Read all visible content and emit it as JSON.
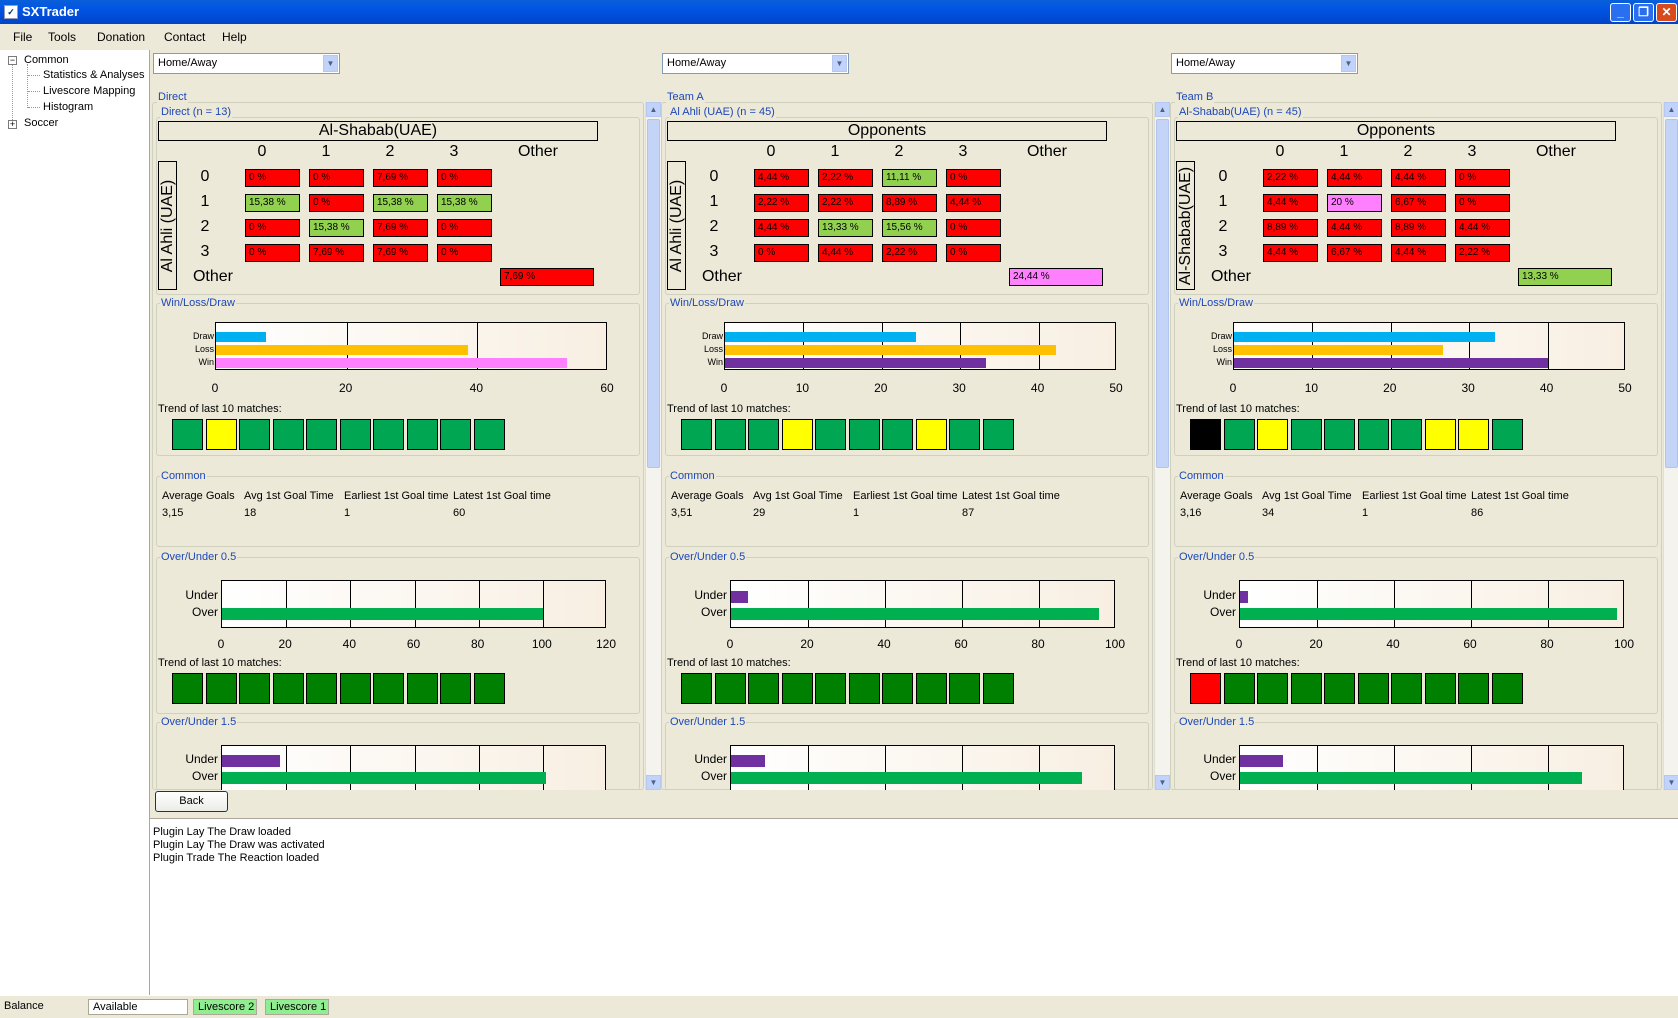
{
  "window": {
    "title": "SXTrader"
  },
  "menu": [
    "File",
    "Tools",
    "Donation",
    "Contact",
    "Help"
  ],
  "tree": {
    "common": "Common",
    "children": [
      "Statistics & Analyses",
      "Livescore Mapping",
      "Histogram"
    ],
    "soccer": "Soccer"
  },
  "panels": [
    {
      "combo": "Home/Away",
      "section": "Direct",
      "matrix_caption": "Direct (n = 13)",
      "matrix_header": "Al-Shabab(UAE)",
      "matrix_side": "Al Ahli (UAE)",
      "cols": [
        "0",
        "1",
        "2",
        "3",
        "Other"
      ],
      "rows": [
        "0",
        "1",
        "2",
        "3"
      ],
      "other_label": "Other",
      "cells": [
        [
          "0 %",
          "0 %",
          "7,69 %",
          "0 %"
        ],
        [
          "15,38 %",
          "0 %",
          "15,38 %",
          "15,38 %"
        ],
        [
          "0 %",
          "15,38 %",
          "7,69 %",
          "0 %"
        ],
        [
          "0 %",
          "7,69 %",
          "7,69 %",
          "0 %"
        ]
      ],
      "cell_colors": [
        [
          "#ff0000",
          "#ff0000",
          "#ff0000",
          "#ff0000"
        ],
        [
          "#92d050",
          "#ff0000",
          "#92d050",
          "#92d050"
        ],
        [
          "#ff0000",
          "#92d050",
          "#ff0000",
          "#ff0000"
        ],
        [
          "#ff0000",
          "#ff0000",
          "#ff0000",
          "#ff0000"
        ]
      ],
      "other_value": "7,69 %",
      "other_color": "#ff0000",
      "wld": {
        "caption": "Win/Loss/Draw",
        "labels": [
          "Draw",
          "Loss",
          "Win"
        ],
        "values": [
          7.7,
          38.5,
          53.8
        ],
        "colors": [
          "#00b0f0",
          "#ffc000",
          "#ff80ff"
        ],
        "ticks": [
          "0",
          "20",
          "40",
          "60"
        ],
        "max": 60
      },
      "trend_label": "Trend of last 10 matches:",
      "trend1": [
        "#00a651",
        "#ffff00",
        "#00a651",
        "#00a651",
        "#00a651",
        "#00a651",
        "#00a651",
        "#00a651",
        "#00a651",
        "#00a651"
      ],
      "common": {
        "caption": "Common",
        "headers": [
          "Average Goals",
          "Avg 1st Goal Time",
          "Earliest 1st Goal time",
          "Latest 1st Goal time"
        ],
        "values": [
          "3,15",
          "18",
          "1",
          "60"
        ]
      },
      "ou05": {
        "caption": "Over/Under 0.5",
        "labels": [
          "Under",
          "Over"
        ],
        "values": [
          0,
          100
        ],
        "ticks": [
          "0",
          "20",
          "40",
          "60",
          "80",
          "100",
          "120"
        ],
        "max": 120
      },
      "trend2": [
        "#008000",
        "#008000",
        "#008000",
        "#008000",
        "#008000",
        "#008000",
        "#008000",
        "#008000",
        "#008000",
        "#008000"
      ],
      "ou15": {
        "caption": "Over/Under 1.5",
        "labels": [
          "Under",
          "Over"
        ],
        "values": [
          18,
          101
        ],
        "max": 120
      }
    },
    {
      "combo": "Home/Away",
      "section": "Team A",
      "matrix_caption": "Al Ahli (UAE) (n = 45)",
      "matrix_header": "Opponents",
      "matrix_side": "Al Ahli (UAE)",
      "cols": [
        "0",
        "1",
        "2",
        "3",
        "Other"
      ],
      "rows": [
        "0",
        "1",
        "2",
        "3"
      ],
      "other_label": "Other",
      "cells": [
        [
          "4,44 %",
          "2,22 %",
          "11,11 %",
          "0 %"
        ],
        [
          "2,22 %",
          "2,22 %",
          "8,89 %",
          "4,44 %"
        ],
        [
          "4,44 %",
          "13,33 %",
          "15,56 %",
          "0 %"
        ],
        [
          "0 %",
          "4,44 %",
          "2,22 %",
          "0 %"
        ]
      ],
      "cell_colors": [
        [
          "#ff0000",
          "#ff0000",
          "#92d050",
          "#ff0000"
        ],
        [
          "#ff0000",
          "#ff0000",
          "#ff0000",
          "#ff0000"
        ],
        [
          "#ff0000",
          "#92d050",
          "#92d050",
          "#ff0000"
        ],
        [
          "#ff0000",
          "#ff0000",
          "#ff0000",
          "#ff0000"
        ]
      ],
      "other_value": "24,44 %",
      "other_color": "#ff80ff",
      "wld": {
        "caption": "Win/Loss/Draw",
        "labels": [
          "Draw",
          "Loss",
          "Win"
        ],
        "values": [
          24.4,
          42.2,
          33.3
        ],
        "colors": [
          "#00b0f0",
          "#ffc000",
          "#7030a0"
        ],
        "ticks": [
          "0",
          "10",
          "20",
          "30",
          "40",
          "50"
        ],
        "max": 50
      },
      "trend_label": "Trend of last 10 matches:",
      "trend1": [
        "#00a651",
        "#00a651",
        "#00a651",
        "#ffff00",
        "#00a651",
        "#00a651",
        "#00a651",
        "#ffff00",
        "#00a651",
        "#00a651"
      ],
      "common": {
        "caption": "Common",
        "headers": [
          "Average Goals",
          "Avg 1st Goal Time",
          "Earliest 1st Goal time",
          "Latest 1st Goal time"
        ],
        "values": [
          "3,51",
          "29",
          "1",
          "87"
        ]
      },
      "ou05": {
        "caption": "Over/Under 0.5",
        "labels": [
          "Under",
          "Over"
        ],
        "values": [
          4.4,
          95.6
        ],
        "ticks": [
          "0",
          "20",
          "40",
          "60",
          "80",
          "100"
        ],
        "max": 100
      },
      "trend2": [
        "#008000",
        "#008000",
        "#008000",
        "#008000",
        "#008000",
        "#008000",
        "#008000",
        "#008000",
        "#008000",
        "#008000"
      ],
      "ou15": {
        "caption": "Over/Under 1.5",
        "labels": [
          "Under",
          "Over"
        ],
        "values": [
          8.9,
          91.1
        ],
        "max": 100
      }
    },
    {
      "combo": "Home/Away",
      "section": "Team B",
      "matrix_caption": "Al-Shabab(UAE) (n = 45)",
      "matrix_header": "Opponents",
      "matrix_side": "Al-Shabab(UAE)",
      "cols": [
        "0",
        "1",
        "2",
        "3",
        "Other"
      ],
      "rows": [
        "0",
        "1",
        "2",
        "3"
      ],
      "other_label": "Other",
      "cells": [
        [
          "2,22 %",
          "4,44 %",
          "4,44 %",
          "0 %"
        ],
        [
          "4,44 %",
          "20 %",
          "6,67 %",
          "0 %"
        ],
        [
          "8,89 %",
          "4,44 %",
          "8,89 %",
          "4,44 %"
        ],
        [
          "4,44 %",
          "6,67 %",
          "4,44 %",
          "2,22 %"
        ]
      ],
      "cell_colors": [
        [
          "#ff0000",
          "#ff0000",
          "#ff0000",
          "#ff0000"
        ],
        [
          "#ff0000",
          "#ff80ff",
          "#ff0000",
          "#ff0000"
        ],
        [
          "#ff0000",
          "#ff0000",
          "#ff0000",
          "#ff0000"
        ],
        [
          "#ff0000",
          "#ff0000",
          "#ff0000",
          "#ff0000"
        ]
      ],
      "other_value": "13,33 %",
      "other_color": "#92d050",
      "wld": {
        "caption": "Win/Loss/Draw",
        "labels": [
          "Draw",
          "Loss",
          "Win"
        ],
        "values": [
          33.3,
          26.7,
          40
        ],
        "colors": [
          "#00b0f0",
          "#ffc000",
          "#7030a0"
        ],
        "ticks": [
          "0",
          "10",
          "20",
          "30",
          "40",
          "50"
        ],
        "max": 50
      },
      "trend_label": "Trend of last 10 matches:",
      "trend1": [
        "#000000",
        "#00a651",
        "#ffff00",
        "#00a651",
        "#00a651",
        "#00a651",
        "#00a651",
        "#ffff00",
        "#ffff00",
        "#00a651"
      ],
      "common": {
        "caption": "Common",
        "headers": [
          "Average Goals",
          "Avg 1st Goal Time",
          "Earliest 1st Goal time",
          "Latest 1st Goal time"
        ],
        "values": [
          "3,16",
          "34",
          "1",
          "86"
        ]
      },
      "ou05": {
        "caption": "Over/Under 0.5",
        "labels": [
          "Under",
          "Over"
        ],
        "values": [
          2.2,
          97.8
        ],
        "ticks": [
          "0",
          "20",
          "40",
          "60",
          "80",
          "100"
        ],
        "max": 100
      },
      "trend2": [
        "#ff0000",
        "#008000",
        "#008000",
        "#008000",
        "#008000",
        "#008000",
        "#008000",
        "#008000",
        "#008000",
        "#008000"
      ],
      "ou15": {
        "caption": "Over/Under 1.5",
        "labels": [
          "Under",
          "Over"
        ],
        "values": [
          11.1,
          88.9
        ],
        "max": 100
      }
    }
  ],
  "back_label": "Back",
  "log": [
    "Plugin Lay The Draw loaded",
    "Plugin Lay The Draw was activated",
    "Plugin Trade The Reaction loaded"
  ],
  "status": {
    "balance": "Balance",
    "available": "Available",
    "live2": "Livescore 2",
    "live1": "Livescore 1"
  }
}
